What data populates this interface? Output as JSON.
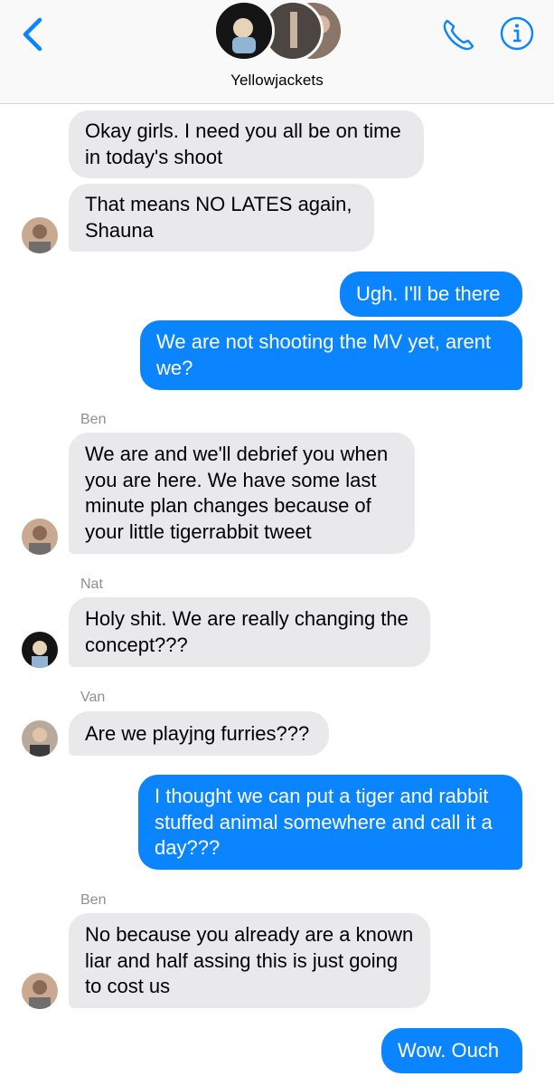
{
  "header": {
    "title": "Yellowjackets",
    "back_icon": "chevron-left-icon",
    "call_icon": "phone-icon",
    "info_icon": "info-icon",
    "accent": "#0b84ff"
  },
  "messages": [
    {
      "dir": "in",
      "text": "Okay girls. I need you all be on time\nin today's shoot"
    },
    {
      "dir": "in",
      "text": "That means NO LATES again,\nShauna"
    },
    {
      "dir": "out",
      "text": "Ugh. I'll be there"
    },
    {
      "dir": "out",
      "text": "We are not shooting the MV yet, arent\nwe?"
    },
    {
      "dir": "in",
      "sender": "Ben",
      "text": "We are and we'll debrief you when\nyou are here. We have some last\nminute plan changes because of\nyour little tigerrabbit tweet"
    },
    {
      "dir": "in",
      "sender": "Nat",
      "text": "Holy shit. We are really changing the\nconcept???"
    },
    {
      "dir": "in",
      "sender": "Van",
      "text": "Are we playjng furries???"
    },
    {
      "dir": "out",
      "text": "I thought we can put a tiger and rabbit\nstuffed animal somewhere and call it a\nday???"
    },
    {
      "dir": "in",
      "sender": "Ben",
      "text": "No because you already are a known\nliar and half assing this is just going\nto cost us"
    },
    {
      "dir": "out",
      "text": "Wow. Ouch"
    }
  ],
  "colors": {
    "incoming_bubble": "#e9e9eb",
    "outgoing_bubble": "#0b84ff",
    "sender_label": "#8e8e93"
  }
}
